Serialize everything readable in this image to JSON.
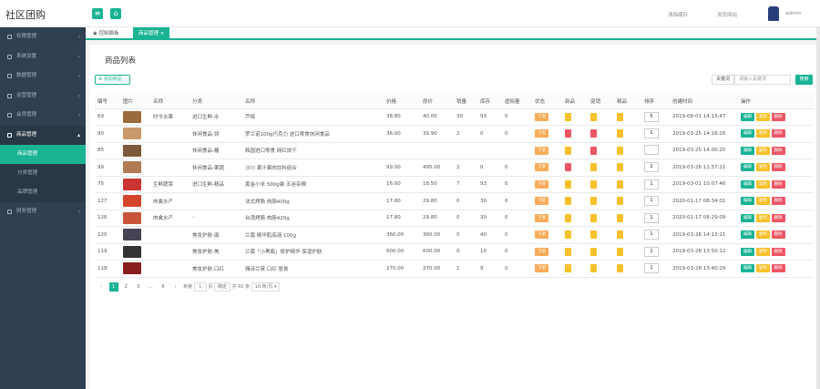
{
  "brand": "社区团购",
  "topbar": {
    "clear_cache": "清除缓存",
    "view_site": "浏览网站",
    "user": "admin"
  },
  "sidebar": {
    "items": [
      {
        "label": "权限管理"
      },
      {
        "label": "系统设置"
      },
      {
        "label": "数据管理"
      },
      {
        "label": "运营管理"
      },
      {
        "label": "会员管理"
      },
      {
        "label": "商品管理"
      },
      {
        "label": "财务管理"
      }
    ],
    "sub_items": [
      {
        "label": "商品管理"
      },
      {
        "label": "分类管理"
      },
      {
        "label": "品牌管理"
      }
    ]
  },
  "tabs": [
    {
      "label": "控制面板"
    },
    {
      "label": "商品管理 ×"
    }
  ],
  "page": {
    "title": "商品列表",
    "add_button": "添加商品",
    "search_label": "关键词",
    "search_placeholder": "请输入关键词",
    "search_button": "搜索"
  },
  "table": {
    "headers": [
      "编号",
      "图片",
      "名称",
      "分类",
      "名称",
      "价格",
      "原价",
      "销量",
      "库存",
      "虚拟量",
      "状态",
      "新品",
      "促销",
      "精品",
      "排序",
      "创建时间",
      "操作"
    ],
    "rows": [
      {
        "id": "69",
        "name1": "时令水果",
        "cat": "进口生鲜-水",
        "name2": "芦柑",
        "price": "38.80",
        "orig": "40.00",
        "sales": "30",
        "stock": "93",
        "virt": "0",
        "sort": "5",
        "time": "2019-08-01 14:13:47"
      },
      {
        "id": "90",
        "name1": "",
        "cat": "休闲食品-饼",
        "name2": "罗兰诺100g巧克力 进口零食休闲食品",
        "price": "36.00",
        "orig": "39.90",
        "sales": "2",
        "stock": "0",
        "virt": "0",
        "sort": "1",
        "time": "2019-03-25 14:16:26"
      },
      {
        "id": "85",
        "name1": "",
        "cat": "休闲食品-糖",
        "name2": "韩国进口零食 网红饼干",
        "price": "",
        "orig": "",
        "sales": "",
        "stock": "",
        "virt": "",
        "sort": "",
        "time": "2019-03-25 14:00:20"
      },
      {
        "id": "99",
        "name1": "",
        "cat": "休闲食品-果蔬",
        "name2": "沙川 果汁果肉饮料组合",
        "price": "99.00",
        "orig": "495.00",
        "sales": "2",
        "stock": "0",
        "virt": "0",
        "sort": "1",
        "time": "2019-03-26 11:57:21"
      },
      {
        "id": "75",
        "name1": "生鲜蔬菜",
        "cat": "进口生鲜-精品",
        "name2": "黄金小米 500g装 五谷杂粮",
        "price": "16.00",
        "orig": "16.50",
        "sales": "7",
        "stock": "93",
        "virt": "0",
        "sort": "1",
        "time": "2019-03-01 10:07:46"
      },
      {
        "id": "127",
        "name1": "肉禽水产",
        "cat": "",
        "name2": "法式烤肠 肉肠400g",
        "price": "17.80",
        "orig": "29.80",
        "sales": "0",
        "stock": "30",
        "virt": "0",
        "sort": "1",
        "time": "2020-01-17 08:34:01"
      },
      {
        "id": "126",
        "name1": "肉禽水产",
        "cat": "-",
        "name2": "台湾烤肠 肉肠420g",
        "price": "17.80",
        "orig": "29.80",
        "sales": "0",
        "stock": "30",
        "virt": "0",
        "sort": "1",
        "time": "2020-01-17 08:29:09"
      },
      {
        "id": "120",
        "name1": "",
        "cat": "美妆护肤-面",
        "name2": "兰蔻 精华肌底液 100g",
        "price": "360.00",
        "orig": "360.00",
        "sales": "0",
        "stock": "40",
        "virt": "0",
        "sort": "1",
        "time": "2019-03-26 14:13:21"
      },
      {
        "id": "119",
        "name1": "",
        "cat": "美妆护肤-美",
        "name2": "兰蔻「小黑瓶」修护精华 保湿护肤",
        "price": "600.00",
        "orig": "600.00",
        "sales": "0",
        "stock": "10",
        "virt": "0",
        "sort": "1",
        "time": "2019-03-28 13:50:12"
      },
      {
        "id": "118",
        "name1": "",
        "cat": "美妆护肤-口红",
        "name2": "雅诗兰黛 口红 唇膏",
        "price": "270.00",
        "orig": "270.00",
        "sales": "1",
        "stock": "9",
        "virt": "0",
        "sort": "1",
        "time": "2019-03-28 13:40:29"
      }
    ],
    "badges": {
      "status": "下架",
      "new": "新品",
      "promo": "促销",
      "best": "精品"
    },
    "ops": {
      "edit": "编辑",
      "copy": "复制",
      "del": "删除"
    }
  },
  "pager": {
    "prev": "‹",
    "pages": [
      "1",
      "2",
      "3",
      "…",
      "6"
    ],
    "next": "›",
    "goto": "到第",
    "page_input": "1",
    "page_unit": "页",
    "confirm": "确定",
    "total": "共 60 条",
    "per_page": "10 条/页 ▾"
  },
  "colors": {
    "accent": "#1ab394",
    "sidebar": "#2f4050",
    "warning": "#f8ac59",
    "danger": "#ed5565"
  }
}
